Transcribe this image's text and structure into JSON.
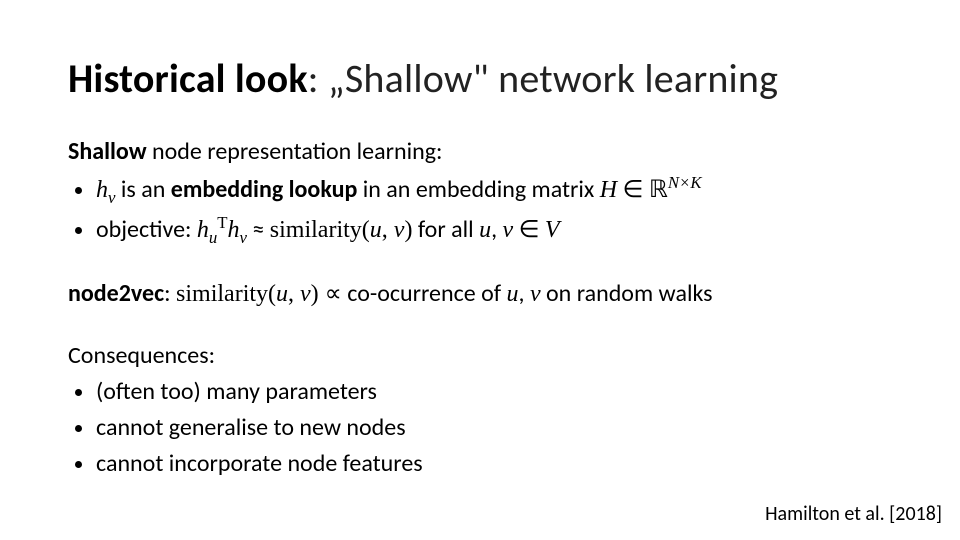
{
  "title": {
    "bold": "Historical look",
    "rest": ": „Shallow\" network learning"
  },
  "section1": {
    "lead_bold": "Shallow",
    "lead_rest": " node representation learning:",
    "bullet1": {
      "p1": "h",
      "sub1": "v",
      "p2": " is an ",
      "boldpart": "embedding lookup",
      "p3": " in an embedding matrix ",
      "H": "H",
      "mem": " ∈ ",
      "R": "ℝ",
      "exp": "N×K"
    },
    "bullet2": {
      "p1": "objective: ",
      "huT": "h",
      "subu": "u",
      "supT": "T",
      "hv": "h",
      "subv": "v",
      "approx": " ≈ ",
      "sim": "similarity(",
      "u": "u",
      "comma": ", ",
      "v": "v",
      "close": ")",
      "forall": " for all ",
      "u2": "u",
      "comma2": ", ",
      "v2": "v",
      "inV": " ∈ ",
      "Vset": "V"
    }
  },
  "section2": {
    "lead": "node2vec",
    "colon": ": ",
    "sim": "similarity(",
    "u": "u",
    "comma": ", ",
    "v": "v",
    "close": ") ",
    "prop": "∝",
    "rest": " co-ocurrence of ",
    "u2": "u",
    "comma2": ", ",
    "v2": "v",
    "rw": " on random walks"
  },
  "section3": {
    "lead": "Consequences:",
    "b1": "(often too) many parameters",
    "b2": "cannot generalise to new nodes",
    "b3": "cannot incorporate node features"
  },
  "citation": {
    "author": "Hamilton et al.",
    "year": " [2018]"
  }
}
